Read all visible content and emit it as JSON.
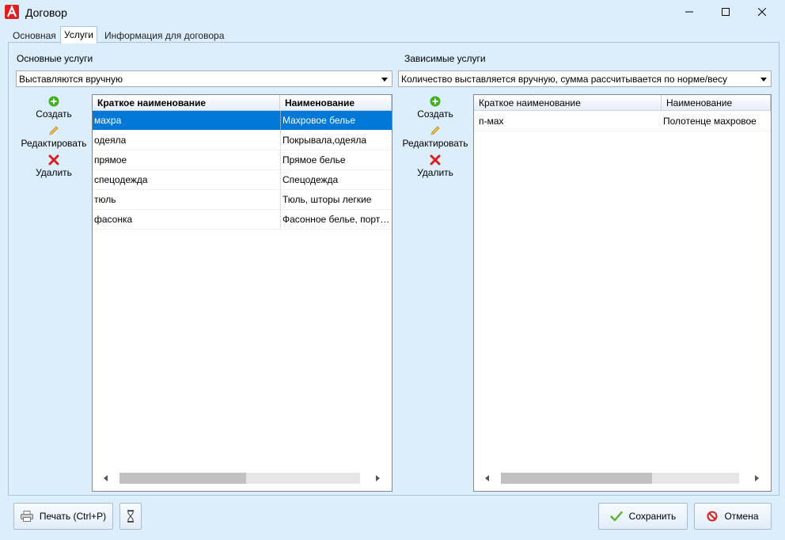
{
  "window": {
    "title": "Договор"
  },
  "tabs": [
    {
      "label": "Основная"
    },
    {
      "label": "Услуги"
    },
    {
      "label": "Информация для договора"
    }
  ],
  "main_services": {
    "label": "Основные услуги",
    "mode": "Выставляются вручную",
    "actions": {
      "create": "Создать",
      "edit": "Редактировать",
      "delete": "Удалить"
    },
    "columns": [
      "Краткое наименование",
      "Наименование"
    ],
    "rows": [
      [
        "махра",
        "Махровое белье"
      ],
      [
        "одеяла",
        "Покрывала,одеяла"
      ],
      [
        "прямое",
        "Прямое белье"
      ],
      [
        "спецодежда",
        "Спецодежда"
      ],
      [
        "тюль",
        "Тюль, шторы легкие"
      ],
      [
        "фасонка",
        "Фасонное белье, порть..."
      ]
    ],
    "selected_row": 0
  },
  "dependent_services": {
    "label": "Зависимые услуги",
    "mode": "Количество выставляется вручную, сумма рассчитывается по норме/весу",
    "actions": {
      "create": "Создать",
      "edit": "Редактировать",
      "delete": "Удалить"
    },
    "columns": [
      "Краткое наименование",
      "Наименование"
    ],
    "rows": [
      [
        "п-мах",
        "Полотенце махровое"
      ]
    ]
  },
  "footer": {
    "print_label": "Печать (Ctrl+P)",
    "save_label": "Сохранить",
    "cancel_label": "Отмена"
  },
  "colors": {
    "selection": "#0078d7",
    "background": "#dcedfb",
    "add_icon": "#3fb21f",
    "delete_icon": "#d81e1e",
    "logo": "#e02020"
  }
}
